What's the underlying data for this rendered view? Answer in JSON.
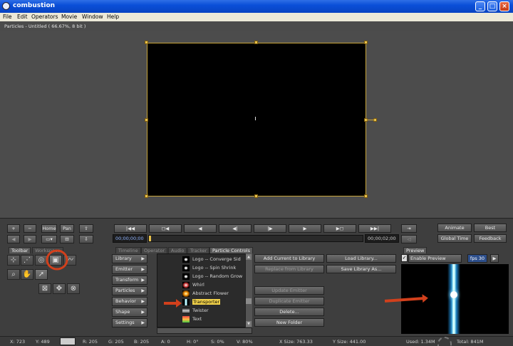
{
  "app": {
    "title": "combustion",
    "document": "Particles - Untitled ( 66.67%, 8 bit )"
  },
  "menu": [
    "File",
    "Edit",
    "Operators",
    "Movie",
    "Window",
    "Help"
  ],
  "view": {
    "home": "Home",
    "pan": "Pan"
  },
  "transport": {
    "time_start": "00;00;00;00",
    "time_end": "00;00;02;00"
  },
  "render": {
    "animate": "Animate",
    "quality": "Best",
    "mode": "Global Time",
    "feedback": "Feedback"
  },
  "panel_tabs": [
    "Timeline",
    "Operator",
    "Audio",
    "Tracker",
    "Particle Controls"
  ],
  "toolbar_tabs": [
    "Toolbar",
    "Workspace"
  ],
  "particle_menu": [
    "Library",
    "Emitter",
    "Transform",
    "Particles",
    "Behavior",
    "Shape",
    "Settings"
  ],
  "library_items": [
    "Logo -- Converge Sid",
    "Logo -- Spin Shrink",
    "Logo -- Random Grow",
    "Whirl",
    "Abstract Flower",
    "Transporter",
    "Twister",
    "Text"
  ],
  "library_selected": "Transporter",
  "actions": {
    "add_current": "Add Current to Library",
    "replace_library": "Replace from Library",
    "update_emitter": "Update Emitter",
    "duplicate_emitter": "Duplicate Emitter",
    "delete": "Delete...",
    "new_folder": "New Folder",
    "load_library": "Load Library...",
    "save_library": "Save Library As..."
  },
  "preview": {
    "tab": "Preview",
    "enable": "Enable Preview",
    "fps": "fps 30"
  },
  "status": {
    "x": "X: 723",
    "y": "Y: 489",
    "r": "R: 205",
    "g": "G: 205",
    "b": "B: 205",
    "a": "A: 0",
    "h": "H: 0°",
    "s": "S: 0%",
    "v": "V: 80%",
    "xsize": "X Size: 763.33",
    "ysize": "Y Size: 441.00",
    "used": "Used: 1.34M",
    "total": "Total: 841M"
  },
  "colors": {
    "accent": "#e8c24a",
    "annotation": "#d2401c"
  }
}
